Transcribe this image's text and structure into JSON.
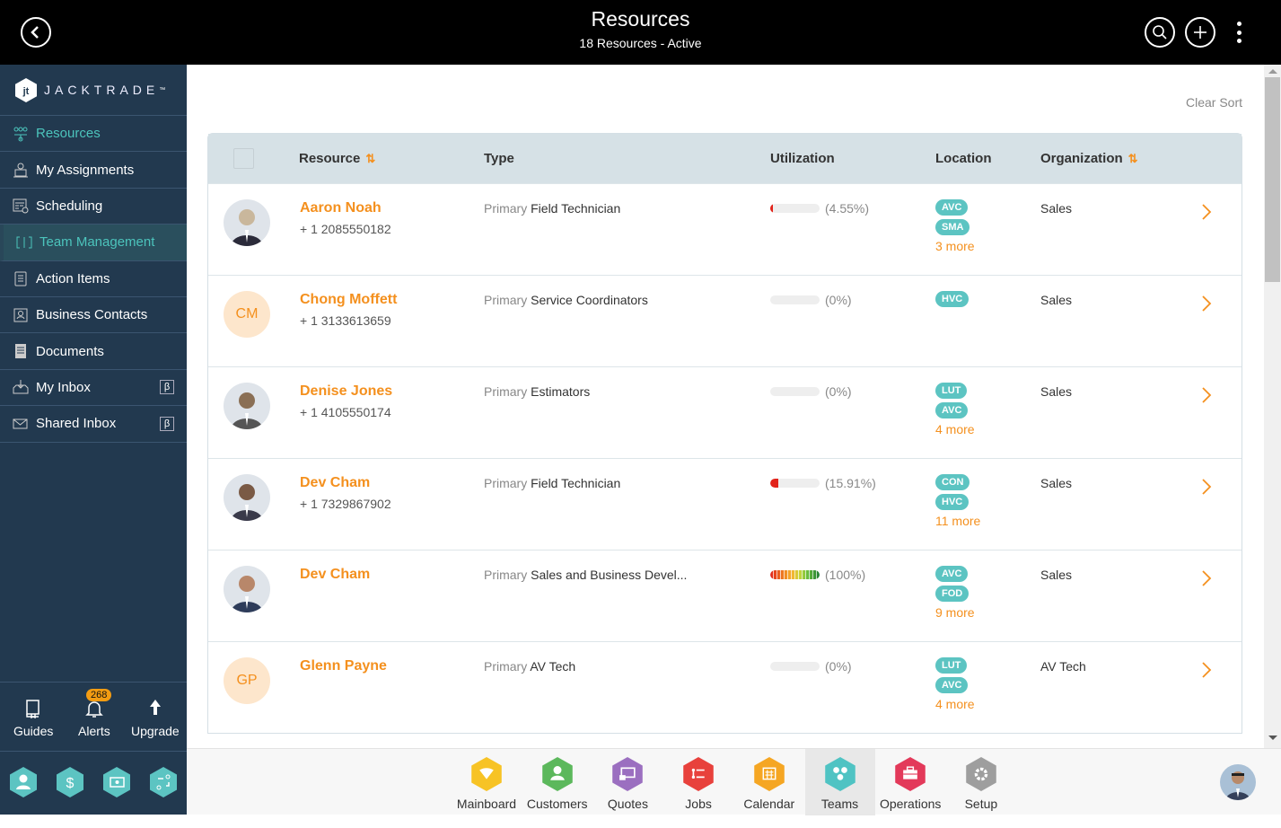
{
  "header": {
    "title": "Resources",
    "subtitle": "18 Resources - Active"
  },
  "brand": {
    "name": "JACKTRADE",
    "tm": "™"
  },
  "sidebar": {
    "items": [
      {
        "label": "Resources",
        "icon": "resources-icon",
        "state": "active"
      },
      {
        "label": "My Assignments",
        "icon": "assignments-icon"
      },
      {
        "label": "Scheduling",
        "icon": "scheduling-icon"
      },
      {
        "label": "Team Management",
        "icon": "team-management-icon",
        "state": "highlight"
      },
      {
        "label": "Action Items",
        "icon": "clipboard-icon"
      },
      {
        "label": "Business Contacts",
        "icon": "contact-card-icon"
      },
      {
        "label": "Documents",
        "icon": "document-icon"
      },
      {
        "label": "My Inbox",
        "icon": "inbox-icon",
        "beta": "β"
      },
      {
        "label": "Shared Inbox",
        "icon": "mail-icon",
        "beta": "β"
      }
    ],
    "tools": {
      "guides": "Guides",
      "alerts": "Alerts",
      "alerts_count": "268",
      "upgrade": "Upgrade"
    }
  },
  "main": {
    "clear_sort": "Clear Sort",
    "columns": {
      "resource": "Resource",
      "type": "Type",
      "utilization": "Utilization",
      "location": "Location",
      "organization": "Organization"
    },
    "rows": [
      {
        "name": "Aaron Noah",
        "phone": "+ 1 2085550182",
        "avatar": "photo",
        "type_prefix": "Primary",
        "type": "Field Technician",
        "util_pct": 4.55,
        "util_label": "(4.55%)",
        "tags": [
          "AVC",
          "SMA"
        ],
        "more": "3 more",
        "org": "Sales"
      },
      {
        "name": "Chong Moffett",
        "phone": "+ 1 3133613659",
        "avatar": "initials",
        "initials": "CM",
        "type_prefix": "Primary",
        "type": "Service Coordinators",
        "util_pct": 0,
        "util_label": "(0%)",
        "tags": [
          "HVC"
        ],
        "more": "",
        "org": "Sales"
      },
      {
        "name": "Denise Jones",
        "phone": "+ 1 4105550174",
        "avatar": "photo",
        "type_prefix": "Primary",
        "type": "Estimators",
        "util_pct": 0,
        "util_label": "(0%)",
        "tags": [
          "LUT",
          "AVC"
        ],
        "more": "4 more",
        "org": "Sales"
      },
      {
        "name": "Dev Cham",
        "phone": "+ 1 7329867902",
        "avatar": "photo",
        "type_prefix": "Primary",
        "type": "Field Technician",
        "util_pct": 15.91,
        "util_label": "(15.91%)",
        "tags": [
          "CON",
          "HVC"
        ],
        "more": "11 more",
        "org": "Sales"
      },
      {
        "name": "Dev Cham",
        "phone": "",
        "avatar": "photo",
        "type_prefix": "Primary",
        "type": "Sales and Business Devel...",
        "util_pct": 100,
        "util_label": "(100%)",
        "tags": [
          "AVC",
          "FOD"
        ],
        "more": "9 more",
        "org": "Sales"
      },
      {
        "name": "Glenn Payne",
        "phone": "",
        "avatar": "initials",
        "initials": "GP",
        "type_prefix": "Primary",
        "type": "AV Tech",
        "util_pct": 0,
        "util_label": "(0%)",
        "tags": [
          "LUT",
          "AVC"
        ],
        "more": "4 more",
        "org": "AV Tech"
      }
    ]
  },
  "bottom_nav": [
    {
      "label": "Mainboard",
      "color": "#f7c325",
      "icon": "mainboard-icon"
    },
    {
      "label": "Customers",
      "color": "#5cb85c",
      "icon": "customer-icon"
    },
    {
      "label": "Quotes",
      "color": "#9b6fc0",
      "icon": "quotes-icon"
    },
    {
      "label": "Jobs",
      "color": "#e8413c",
      "icon": "jobs-icon"
    },
    {
      "label": "Calendar",
      "color": "#f5a623",
      "icon": "calendar-icon"
    },
    {
      "label": "Teams",
      "color": "#4fc3c3",
      "icon": "teams-icon",
      "selected": true
    },
    {
      "label": "Operations",
      "color": "#e3395a",
      "icon": "briefcase-icon"
    },
    {
      "label": "Setup",
      "color": "#9e9e9e",
      "icon": "gear-icon"
    }
  ],
  "colors": {
    "accent": "#f4901e",
    "teal": "#5cc4c2",
    "sidebar_bg": "#22394f",
    "header_bg": "#d6e1e6"
  }
}
